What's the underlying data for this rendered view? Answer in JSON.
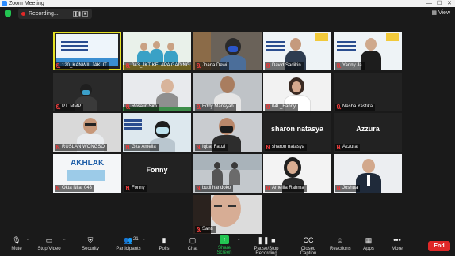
{
  "window": {
    "title": "Zoom Meeting",
    "minimize": "—",
    "maximize": "☐",
    "close": "✕"
  },
  "topbar": {
    "recording_label": "Recording...",
    "view_label": "View"
  },
  "participants": [
    {
      "name": "120_KANWIL JAKUT"
    },
    {
      "name": "043_JKT KELAPA GADING"
    },
    {
      "name": "Joana Dewi"
    },
    {
      "name": "David Sadikin"
    },
    {
      "name": "Yanny Ja"
    },
    {
      "name": "PT. MMP"
    },
    {
      "name": "Rosalin Sim"
    },
    {
      "name": "Eddy Mansyah"
    },
    {
      "name": "04L_Fanny"
    },
    {
      "name": "Nasha Yasfika"
    },
    {
      "name": "RUSLAN WONGSO"
    },
    {
      "name": "Gita Amelia"
    },
    {
      "name": "Iqbal Fauzi"
    },
    {
      "name": "sharon natasya",
      "display_text": "sharon natasya"
    },
    {
      "name": "Azzura",
      "display_text": "Azzura"
    },
    {
      "name": "Okta Nila_043"
    },
    {
      "name": "Fonny",
      "display_text": "Fonny"
    },
    {
      "name": "budi handoko"
    },
    {
      "name": "Amellia Rahma"
    },
    {
      "name": "Joshua"
    },
    {
      "name": "Santi"
    }
  ],
  "tiles_misc": {
    "akhlak_text": "AKHLAK"
  },
  "toolbar": {
    "mute": "Mute",
    "stop_video": "Stop Video",
    "security": "Security",
    "participants": "Participants",
    "participants_count": "21",
    "polls": "Polls",
    "chat": "Chat",
    "share_screen": "Share Screen",
    "pause_recording": "Pause/Stop Recording",
    "closed_caption": "Closed Caption",
    "reactions": "Reactions",
    "apps": "Apps",
    "more": "More",
    "end": "End"
  },
  "colors": {
    "active_speaker": "#e6e224",
    "share_green": "#23c552",
    "end_red": "#e02828",
    "recording_red": "#e02828"
  }
}
